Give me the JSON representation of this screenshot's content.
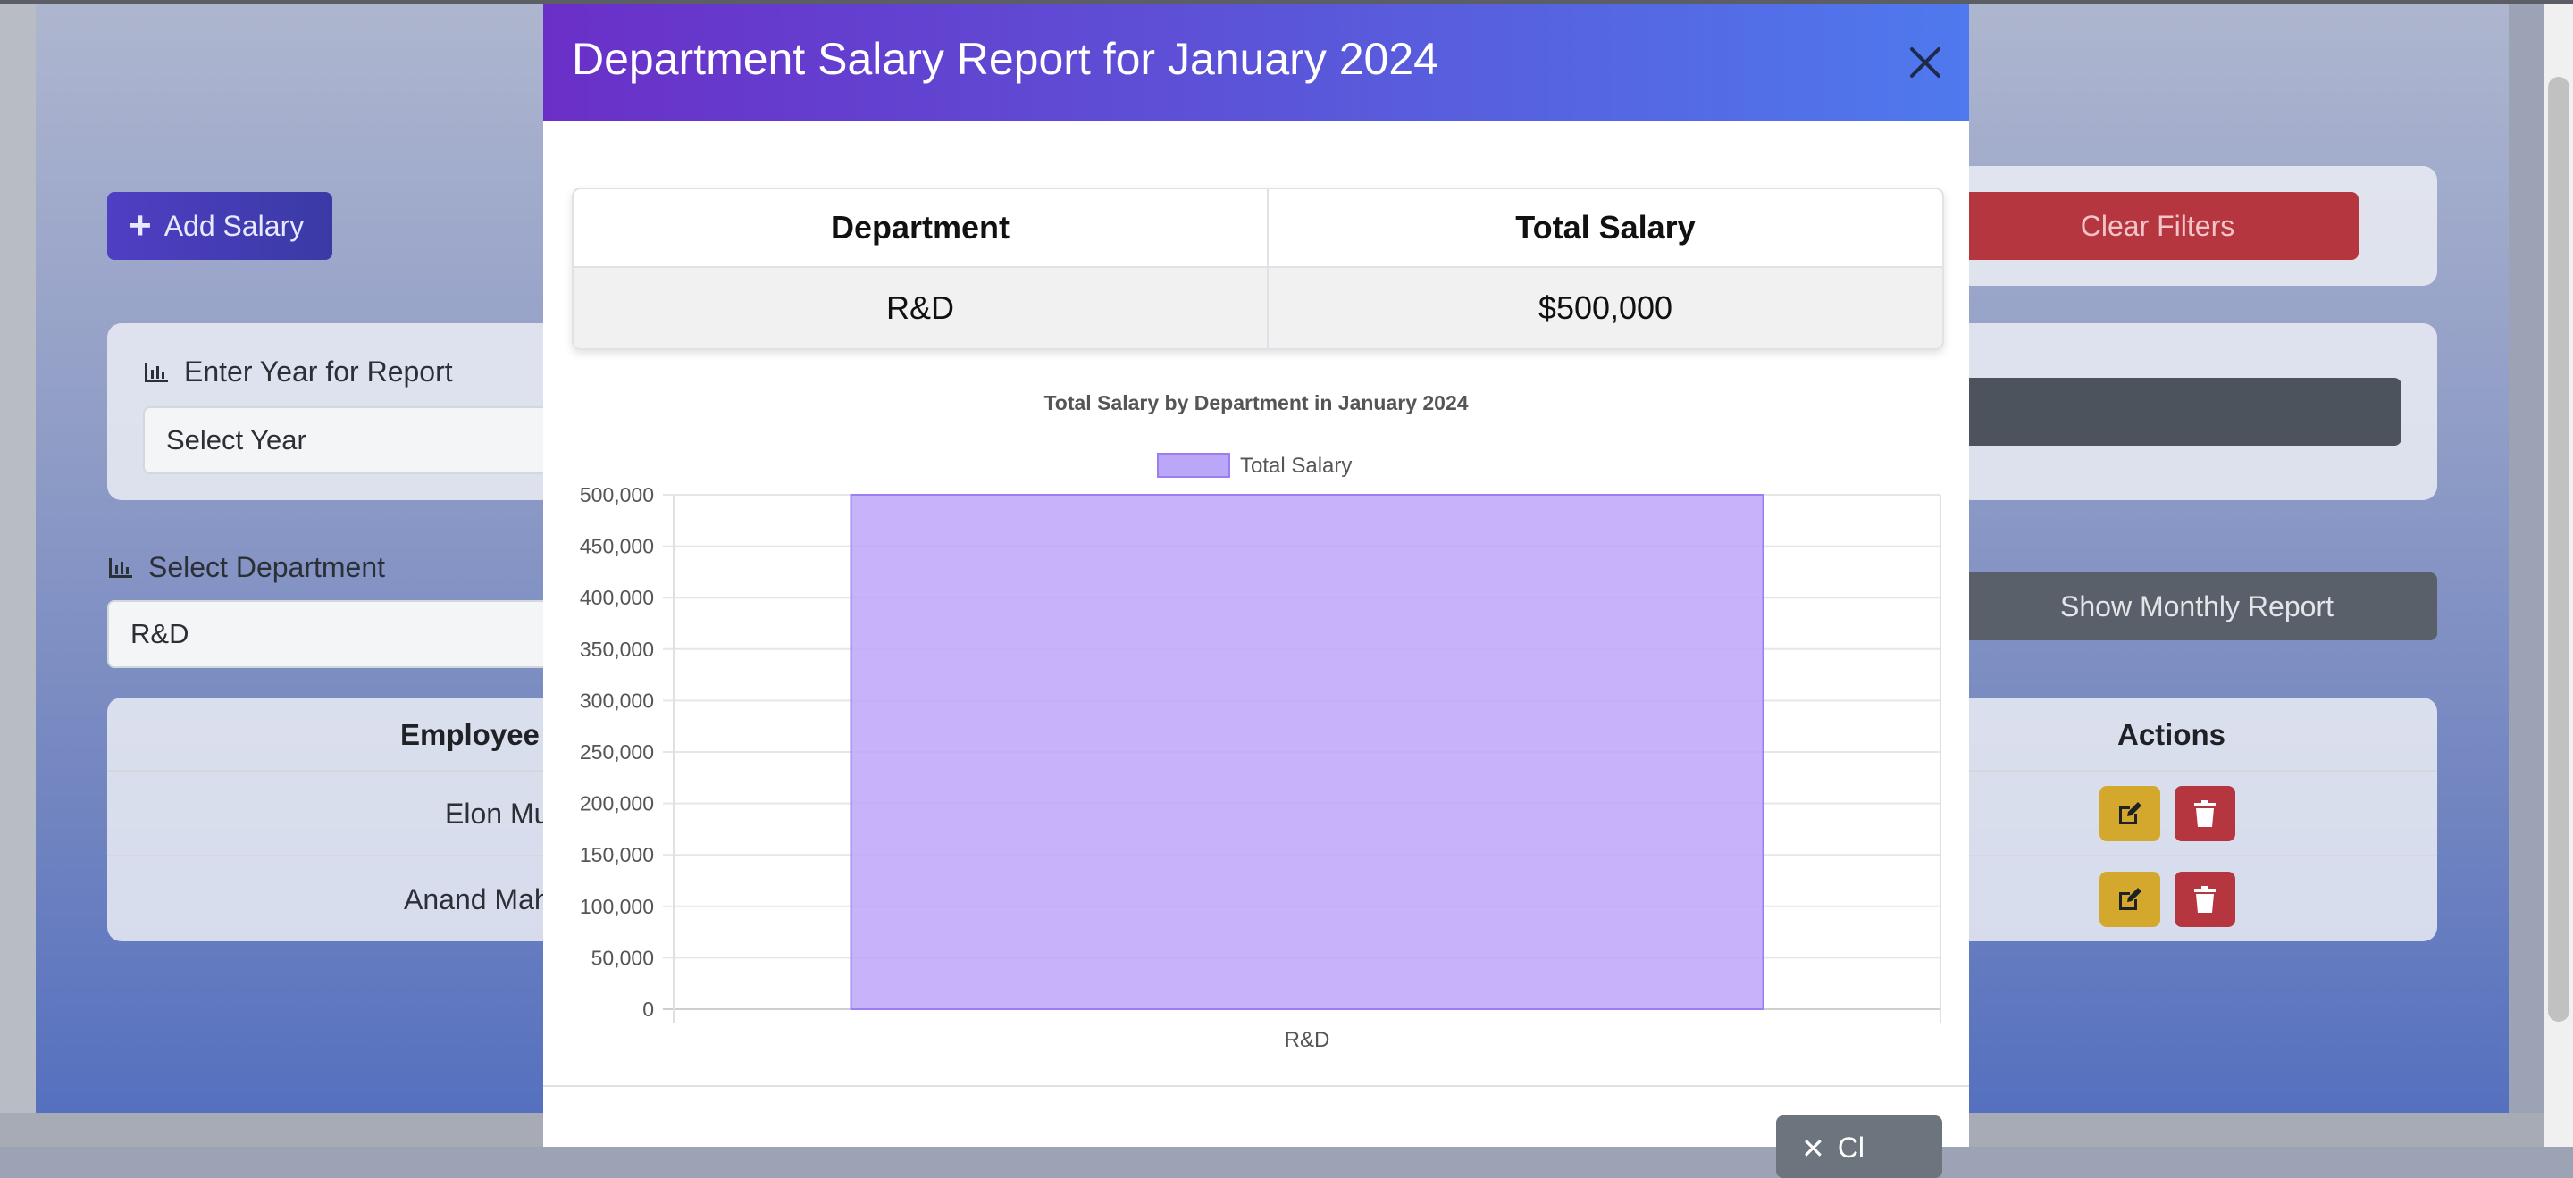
{
  "background": {
    "add_salary_label": "Add Salary",
    "year_report_label": "Enter Year for Report",
    "year_placeholder": "Select Year",
    "department_label": "Select Department",
    "department_value": "R&D",
    "clear_filters_label": "Clear Filters",
    "show_monthly_label": "Show Monthly Report",
    "table_headers": {
      "employee": "Employee",
      "actions": "Actions"
    },
    "employees": [
      "Elon Mu",
      "Anand Mah"
    ]
  },
  "modal": {
    "title": "Department Salary Report for January 2024",
    "table": {
      "headers": [
        "Department",
        "Total Salary"
      ],
      "rows": [
        [
          "R&D",
          "$500,000"
        ]
      ]
    },
    "footer_button_label": "Cl"
  },
  "chart_data": {
    "type": "bar",
    "title": "Total Salary by Department in January 2024",
    "categories": [
      "R&D"
    ],
    "series": [
      {
        "name": "Total Salary",
        "values": [
          500000
        ],
        "color": "#bca6f8",
        "border": "#9b7ff0"
      }
    ],
    "ylim": [
      0,
      500000
    ],
    "yticks": [
      "0",
      "50,000",
      "100,000",
      "150,000",
      "200,000",
      "250,000",
      "300,000",
      "350,000",
      "400,000",
      "450,000",
      "500,000"
    ],
    "legend": "top",
    "grid": true
  }
}
